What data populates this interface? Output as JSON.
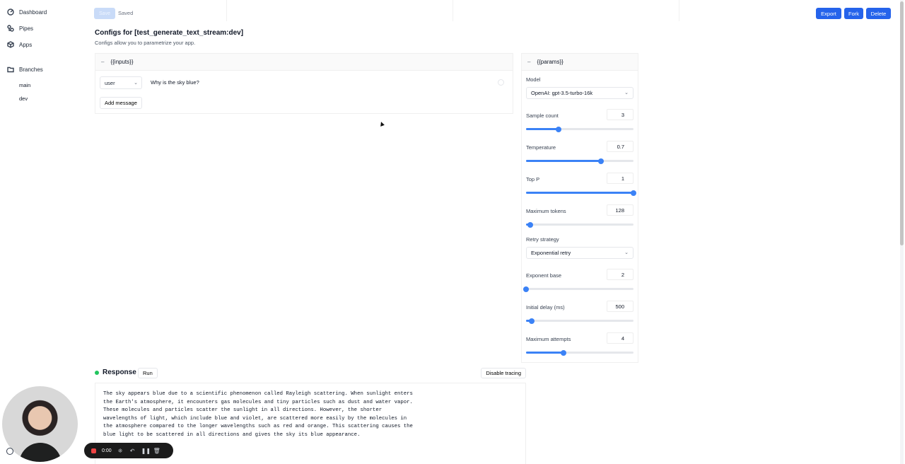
{
  "sidebar": {
    "items": [
      {
        "label": "Dashboard",
        "icon": "dashboard-icon"
      },
      {
        "label": "Pipes",
        "icon": "pipes-icon"
      },
      {
        "label": "Apps",
        "icon": "apps-icon"
      },
      {
        "label": "Branches",
        "icon": "folder-icon"
      }
    ],
    "branches": [
      "main",
      "dev"
    ]
  },
  "toolbar": {
    "save_label": "Save",
    "status": "Saved",
    "export_label": "Export",
    "fork_label": "Fork",
    "delete_label": "Delete",
    "accent": "#2563eb"
  },
  "page": {
    "title": "Configs for [test_generate_text_stream:dev]",
    "subtitle": "Configs allow you to parametrize your app."
  },
  "inputs": {
    "header": "{{inputs}}",
    "message": {
      "role": "user",
      "content": "Why is the sky blue?"
    },
    "add_label": "Add message"
  },
  "params": {
    "header": "{{params}}",
    "model_label": "Model",
    "model_value": "OpenAI: gpt-3.5-turbo-16k",
    "sample_count": {
      "label": "Sample count",
      "value": "3",
      "level": 0.3
    },
    "temperature": {
      "label": "Temperature",
      "value": "0.7",
      "level": 0.7
    },
    "top_p": {
      "label": "Top P",
      "value": "1",
      "level": 1.0
    },
    "max_tokens": {
      "label": "Maximum tokens",
      "value": "128",
      "level": 0.04
    },
    "retry_label": "Retry strategy",
    "retry_value": "Exponential retry",
    "exponent_base": {
      "label": "Exponent base",
      "value": "2",
      "level": 0.0
    },
    "initial_delay": {
      "label": "Initial delay (ms)",
      "value": "500",
      "level": 0.05
    },
    "max_attempts": {
      "label": "Maximum attempts",
      "value": "4",
      "level": 0.35
    }
  },
  "response": {
    "title": "Response",
    "run_label": "Run",
    "tracing_label": "Disable tracing",
    "text": "The sky appears blue due to a scientific phenomenon called Rayleigh scattering. When sunlight enters\nthe Earth's atmosphere, it encounters gas molecules and tiny particles such as dust and water vapor.\nThese molecules and particles scatter the sunlight in all directions. However, the shorter\nwavelengths of light, which include blue and violet, are scattered more easily by the molecules in\nthe atmosphere compared to the longer wavelengths such as red and orange. This scattering causes the\nblue light to be scattered in all directions and gives the sky its blue appearance."
  },
  "recorder": {
    "time": "0:00"
  }
}
